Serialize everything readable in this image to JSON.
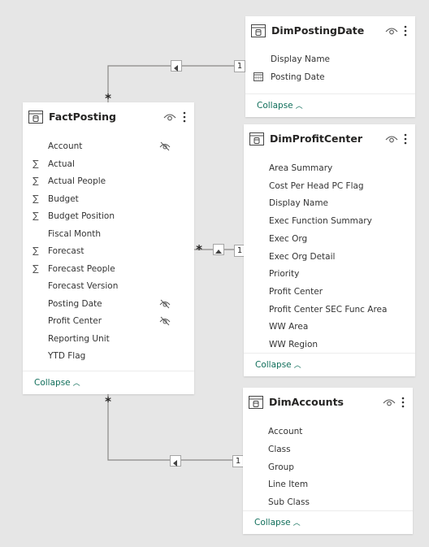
{
  "tables": {
    "fact_posting": {
      "title": "FactPosting",
      "collapse_label": "Collapse",
      "fields": [
        {
          "label": "Account",
          "icon": "none",
          "hidden": true
        },
        {
          "label": "Actual",
          "icon": "sigma",
          "hidden": false
        },
        {
          "label": "Actual People",
          "icon": "sigma",
          "hidden": false
        },
        {
          "label": "Budget",
          "icon": "sigma",
          "hidden": false
        },
        {
          "label": "Budget Position",
          "icon": "sigma",
          "hidden": false
        },
        {
          "label": "Fiscal Month",
          "icon": "none",
          "hidden": false
        },
        {
          "label": "Forecast",
          "icon": "sigma",
          "hidden": false
        },
        {
          "label": "Forecast People",
          "icon": "sigma",
          "hidden": false
        },
        {
          "label": "Forecast Version",
          "icon": "none",
          "hidden": false
        },
        {
          "label": "Posting Date",
          "icon": "none",
          "hidden": true
        },
        {
          "label": "Profit Center",
          "icon": "none",
          "hidden": true
        },
        {
          "label": "Reporting Unit",
          "icon": "none",
          "hidden": false
        },
        {
          "label": "YTD Flag",
          "icon": "none",
          "hidden": false
        }
      ]
    },
    "dim_posting_date": {
      "title": "DimPostingDate",
      "collapse_label": "Collapse",
      "fields": [
        {
          "label": "Display Name",
          "icon": "none",
          "hidden": false
        },
        {
          "label": "Posting Date",
          "icon": "calendar",
          "hidden": false
        }
      ]
    },
    "dim_profit_center": {
      "title": "DimProfitCenter",
      "collapse_label": "Collapse",
      "fields": [
        {
          "label": "Area Summary",
          "icon": "none",
          "hidden": false
        },
        {
          "label": "Cost Per Head PC Flag",
          "icon": "none",
          "hidden": false
        },
        {
          "label": "Display Name",
          "icon": "none",
          "hidden": false
        },
        {
          "label": "Exec Function Summary",
          "icon": "none",
          "hidden": false
        },
        {
          "label": "Exec Org",
          "icon": "none",
          "hidden": false
        },
        {
          "label": "Exec Org Detail",
          "icon": "none",
          "hidden": false
        },
        {
          "label": "Priority",
          "icon": "none",
          "hidden": false
        },
        {
          "label": "Profit Center",
          "icon": "none",
          "hidden": false
        },
        {
          "label": "Profit Center SEC Func Area",
          "icon": "none",
          "hidden": false
        },
        {
          "label": "WW Area",
          "icon": "none",
          "hidden": false
        },
        {
          "label": "WW Region",
          "icon": "none",
          "hidden": false
        }
      ]
    },
    "dim_accounts": {
      "title": "DimAccounts",
      "collapse_label": "Collapse",
      "fields": [
        {
          "label": "Account",
          "icon": "none",
          "hidden": false
        },
        {
          "label": "Class",
          "icon": "none",
          "hidden": false
        },
        {
          "label": "Group",
          "icon": "none",
          "hidden": false
        },
        {
          "label": "Line Item",
          "icon": "none",
          "hidden": false
        },
        {
          "label": "Sub Class",
          "icon": "none",
          "hidden": false
        }
      ]
    }
  },
  "relationships": [
    {
      "from": "DimPostingDate",
      "to": "FactPosting",
      "one_label": "1",
      "many_label": "*"
    },
    {
      "from": "DimProfitCenter",
      "to": "FactPosting",
      "one_label": "1",
      "many_label": "*"
    },
    {
      "from": "DimAccounts",
      "to": "FactPosting",
      "one_label": "1",
      "many_label": "*"
    }
  ],
  "colors": {
    "background": "#e6e6e6",
    "card": "#ffffff",
    "collapse_link": "#0f6e5a",
    "line": "#8a8886"
  }
}
